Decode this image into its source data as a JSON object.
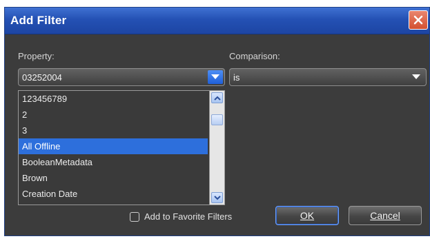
{
  "dialog": {
    "title": "Add Filter"
  },
  "property": {
    "label": "Property:",
    "selected_value": "03252004",
    "list_items": [
      "123456789",
      "2",
      "3",
      "All Offline",
      "BooleanMetadata",
      "Brown",
      "Creation Date"
    ],
    "selected_item": "All Offline"
  },
  "comparison": {
    "label": "Comparison:",
    "selected_value": "is"
  },
  "options": {
    "favorite_label": "Add to Favorite Filters",
    "favorite_checked": false
  },
  "buttons": {
    "ok_label": "OK",
    "cancel_label": "Cancel"
  },
  "colors": {
    "titlebar": "#2451b4",
    "selection": "#2d6fdc",
    "dialog_bg": "#3c3c3c"
  }
}
